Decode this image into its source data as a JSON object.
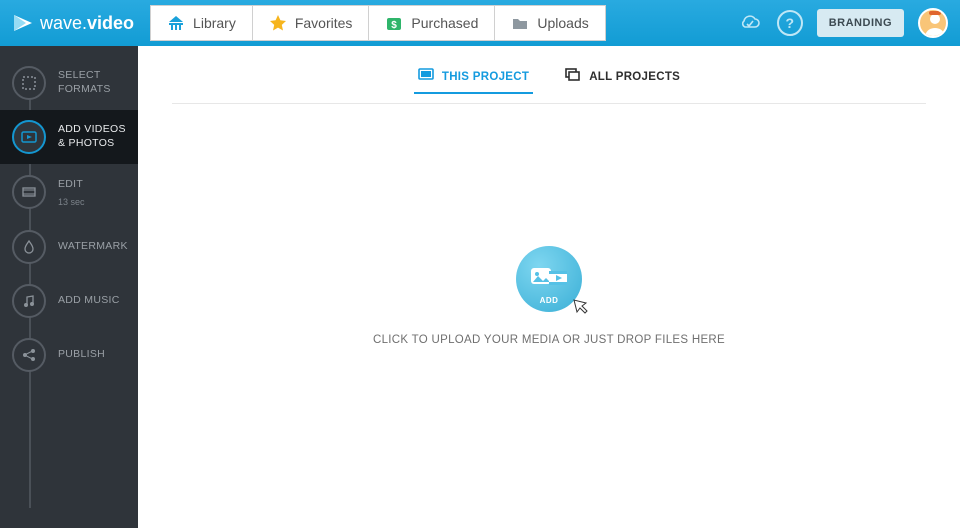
{
  "brand": {
    "name_light": "wave.",
    "name_bold": "video"
  },
  "topnav": {
    "tabs": [
      {
        "label": "Library",
        "icon": "library"
      },
      {
        "label": "Favorites",
        "icon": "star"
      },
      {
        "label": "Purchased",
        "icon": "purchased"
      },
      {
        "label": "Uploads",
        "icon": "uploads",
        "active": true
      }
    ],
    "branding_label": "BRANDING"
  },
  "sidebar": {
    "steps": [
      {
        "label": "SELECT\nFORMATS",
        "icon": "formats"
      },
      {
        "label": "ADD VIDEOS\n& PHOTOS",
        "icon": "media",
        "active": true
      },
      {
        "label": "EDIT",
        "sub": "13 sec",
        "icon": "edit"
      },
      {
        "label": "WATERMARK",
        "icon": "watermark"
      },
      {
        "label": "ADD MUSIC",
        "icon": "music"
      },
      {
        "label": "PUBLISH",
        "icon": "publish"
      }
    ]
  },
  "main": {
    "subtabs": {
      "this_project": "THIS PROJECT",
      "all_projects": "ALL PROJECTS"
    },
    "add_bubble_label": "ADD",
    "upload_hint": "CLICK TO UPLOAD YOUR MEDIA OR JUST DROP FILES HERE"
  },
  "colors": {
    "accent": "#149bdf",
    "topbar": "#1ea3da"
  }
}
